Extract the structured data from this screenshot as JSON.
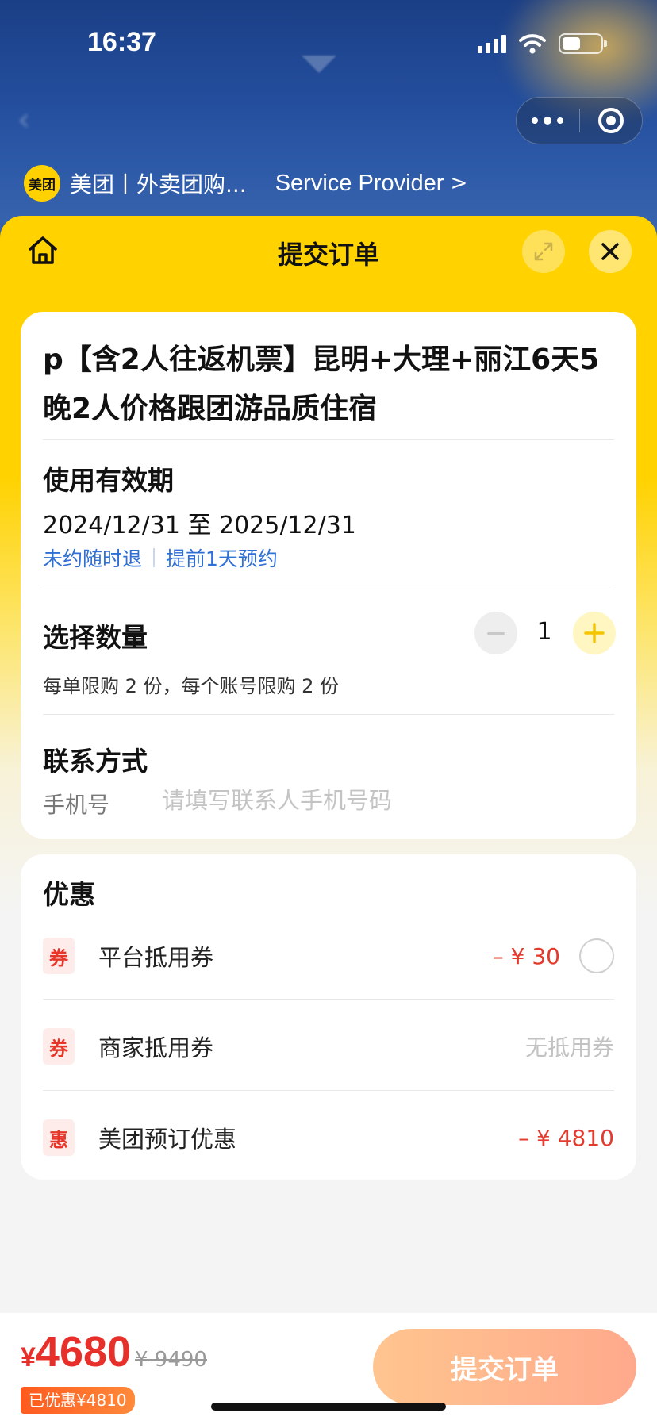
{
  "status_bar": {
    "time": "16:37"
  },
  "mini_program": {
    "app_name": "美团丨外卖团购...",
    "logo_text": "美团",
    "service_provider": "Service Provider",
    "chevron": ">"
  },
  "sheet": {
    "title": "提交订单"
  },
  "product": {
    "title": "p【含2人往返机票】昆明+大理+丽江6天5晚2人价格跟团游品质住宿"
  },
  "validity": {
    "label": "使用有效期",
    "dates": "2024/12/31 至 2025/12/31",
    "tags": [
      "未约随时退",
      "提前1天预约"
    ]
  },
  "quantity": {
    "label": "选择数量",
    "value": "1",
    "limit_text": "每单限购 2 份，每个账号限购 2 份"
  },
  "contact": {
    "label": "联系方式",
    "phone_label": "手机号",
    "phone_value": "",
    "phone_placeholder": "请填写联系人手机号码"
  },
  "discounts": {
    "title": "优惠",
    "rows": [
      {
        "badge": "券",
        "name": "平台抵用券",
        "amount": "– ¥ 30",
        "selected": false
      },
      {
        "badge": "券",
        "name": "商家抵用券",
        "amount": "无抵用券"
      },
      {
        "badge": "惠",
        "name": "美团预订优惠",
        "amount": "– ¥ 4810"
      }
    ]
  },
  "bottom": {
    "currency": "¥",
    "price": "4680",
    "original_price": "¥ 9490",
    "saved": "已优惠¥4810",
    "submit_label": "提交订单"
  },
  "colors": {
    "brand_yellow": "#ffd200",
    "price_red": "#e8302a",
    "link_blue": "#2f6fd6",
    "submit_gradient": [
      "#ffc58f",
      "#ffa98c"
    ]
  }
}
